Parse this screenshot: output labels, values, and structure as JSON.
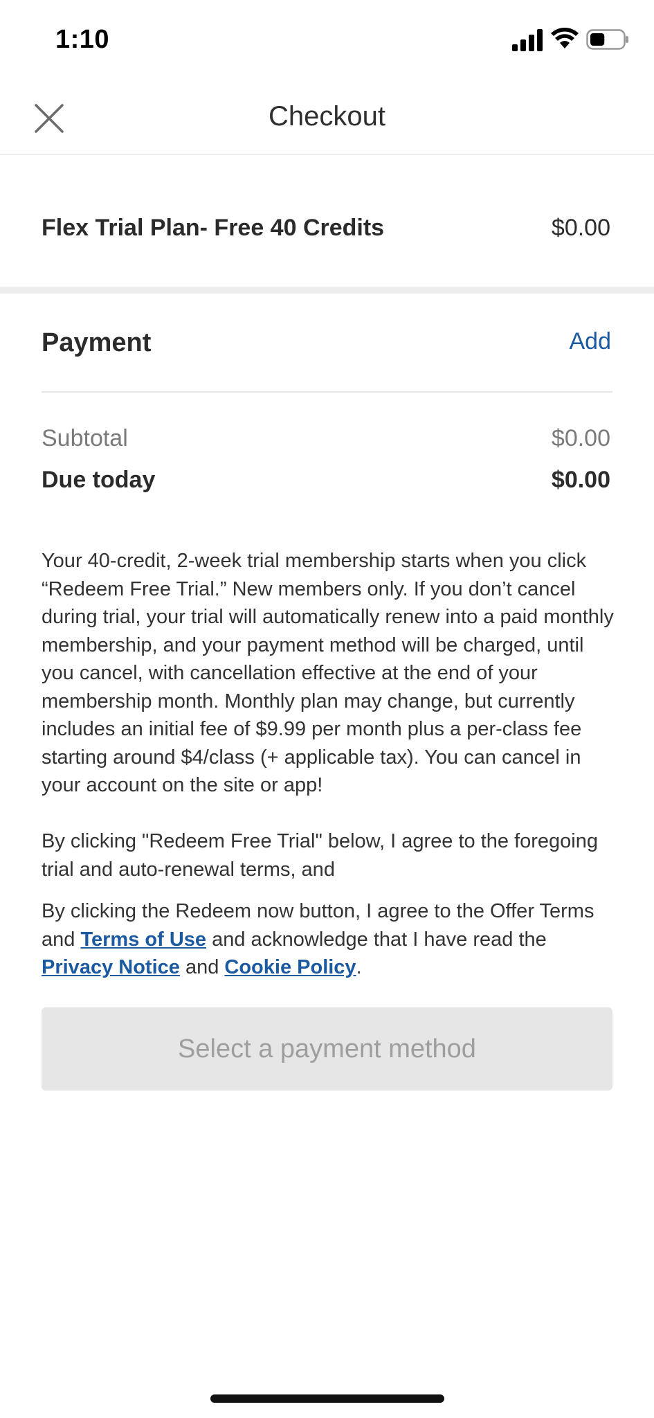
{
  "status_bar": {
    "time": "1:10",
    "icons": [
      "signal-icon",
      "wifi-icon",
      "battery-icon"
    ],
    "battery_level": 0.45
  },
  "header": {
    "title": "Checkout",
    "close_icon": "close-icon"
  },
  "plan": {
    "name": "Flex Trial Plan- Free 40 Credits",
    "price": "$0.00"
  },
  "payment": {
    "label": "Payment",
    "add_label": "Add"
  },
  "totals": {
    "subtotal_label": "Subtotal",
    "subtotal_value": "$0.00",
    "due_label": "Due today",
    "due_value": "$0.00"
  },
  "legal": {
    "trial_terms": "Your 40-credit, 2-week trial membership starts when you click “Redeem Free Trial.” New members only. If you don’t cancel during trial, your trial will automatically renew into a paid monthly membership, and your payment method will be charged, until you cancel, with cancellation effective at the end of your membership month. Monthly plan may change, but currently includes an initial fee of $9.99 per month plus a per-class fee starting around $4/class (+ applicable tax). You can cancel in your account on the site or app!",
    "agree_auto_renewal": "By clicking \"Redeem Free Trial\" below, I agree to the foregoing trial and auto-renewal terms, and",
    "agree_prefix": "By clicking the Redeem now button, I agree to the Offer Terms and ",
    "terms_link": "Terms of Use",
    "agree_middle": " and acknowledge that I have read the ",
    "privacy_link": "Privacy Notice",
    "agree_and": " and ",
    "cookie_link": "Cookie Policy",
    "agree_end": "."
  },
  "cta": {
    "label": "Select a payment method"
  },
  "colors": {
    "link": "#1b5aa1",
    "button_disabled_bg": "#e6e6e6",
    "button_disabled_text": "#9e9e9e",
    "divider": "#ededed"
  }
}
